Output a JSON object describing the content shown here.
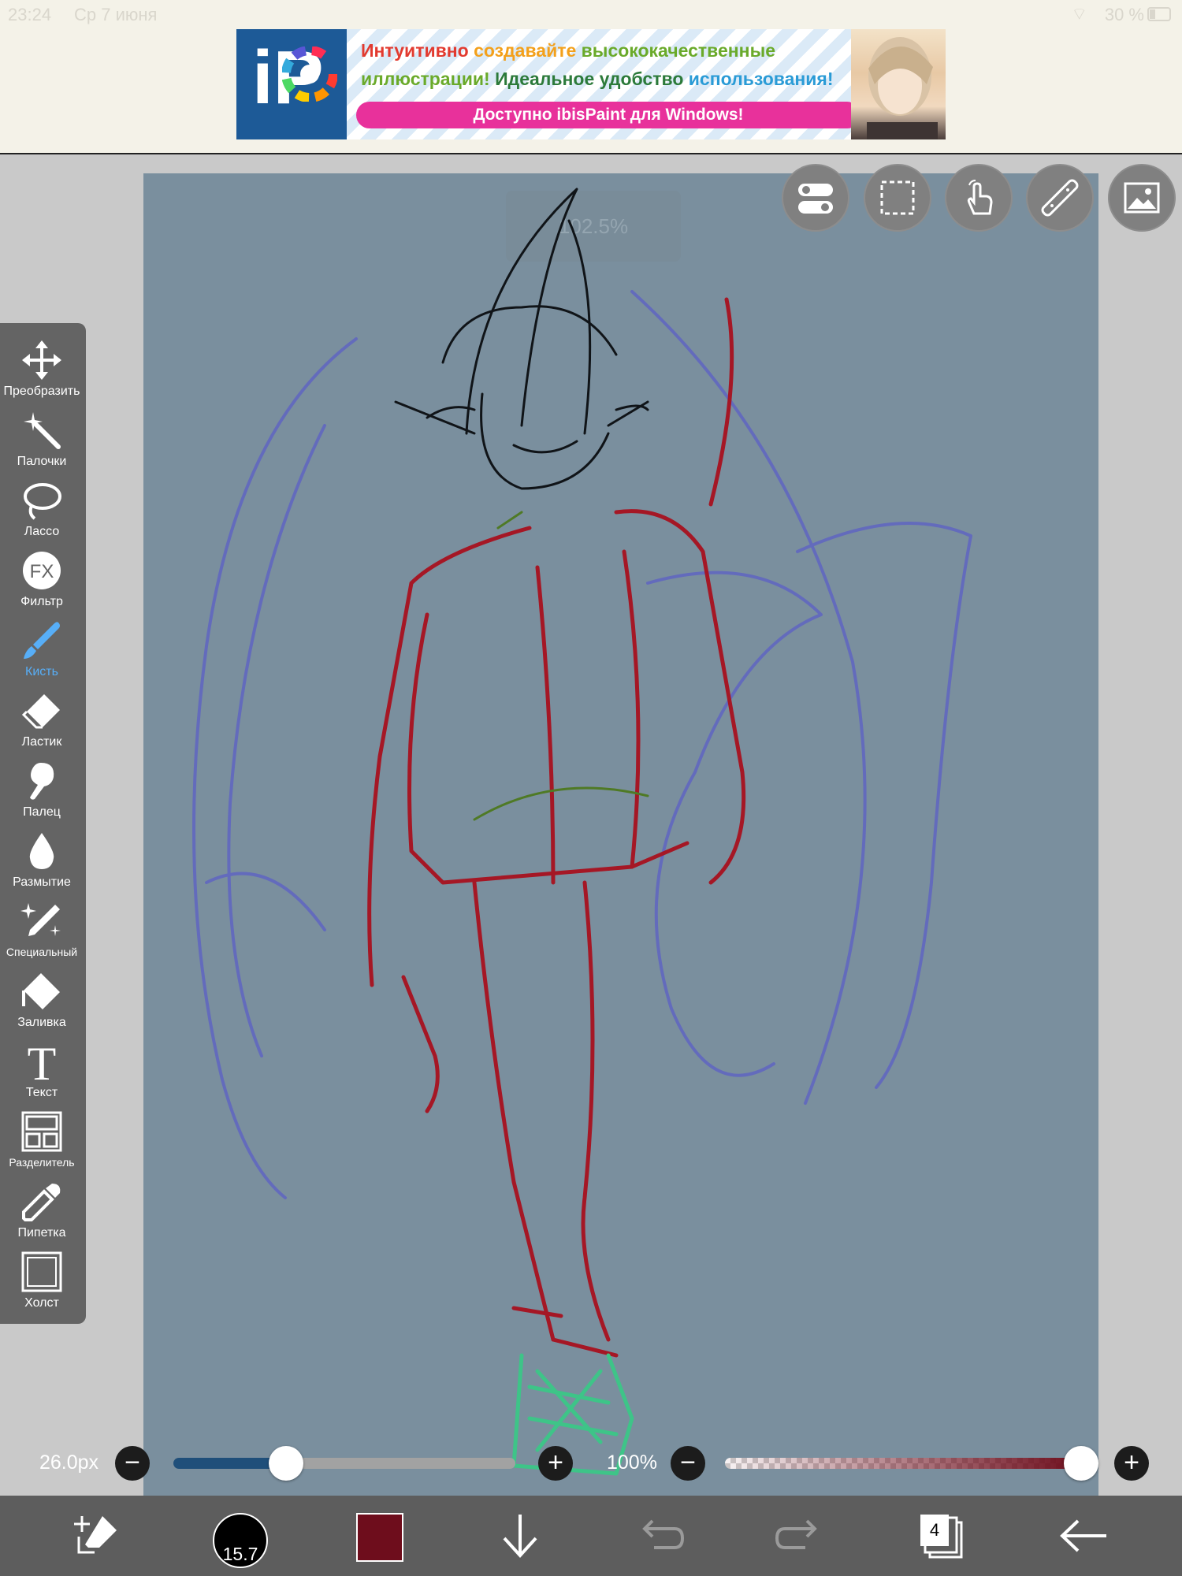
{
  "status_bar": {
    "time": "23:24",
    "date": "Ср 7 июня",
    "battery": "30 %"
  },
  "ad": {
    "line1": [
      {
        "text": "Интуитивно ",
        "color": "#e23a2f"
      },
      {
        "text": "создавайте ",
        "color": "#f3a01b"
      },
      {
        "text": "высококачественные",
        "color": "#6aaa2a"
      }
    ],
    "line2": [
      {
        "text": "иллюстрации! ",
        "color": "#6aaa2a"
      },
      {
        "text": "Идеальное удобство ",
        "color": "#2c7a3a"
      },
      {
        "text": "использования!",
        "color": "#2a9bd6"
      }
    ],
    "cta": "Доступно ibisPaint для Windows!",
    "logo_text": "iP"
  },
  "canvas": {
    "zoom_overlay": "102.5%",
    "background": "#7a8f9e"
  },
  "tools": [
    {
      "name": "transform",
      "label": "Преобразить",
      "icon": "move-arrows-icon"
    },
    {
      "name": "magic-wand",
      "label": "Палочки",
      "icon": "magic-wand-icon"
    },
    {
      "name": "lasso",
      "label": "Лассо",
      "icon": "lasso-icon"
    },
    {
      "name": "filter",
      "label": "Фильтр",
      "icon": "fx-icon"
    },
    {
      "name": "brush",
      "label": "Кисть",
      "icon": "brush-icon",
      "active": true
    },
    {
      "name": "eraser",
      "label": "Ластик",
      "icon": "eraser-icon"
    },
    {
      "name": "smudge",
      "label": "Палец",
      "icon": "finger-icon"
    },
    {
      "name": "blur",
      "label": "Размытие",
      "icon": "drop-icon"
    },
    {
      "name": "special",
      "label": "Специальный",
      "icon": "sparkle-pen-icon"
    },
    {
      "name": "fill",
      "label": "Заливка",
      "icon": "fill-bucket-icon"
    },
    {
      "name": "text",
      "label": "Текст",
      "icon": "text-t-icon"
    },
    {
      "name": "divider",
      "label": "Разделитель",
      "icon": "frame-divider-icon"
    },
    {
      "name": "eyedropper",
      "label": "Пипетка",
      "icon": "eyedropper-icon"
    },
    {
      "name": "canvas",
      "label": "Холст",
      "icon": "canvas-square-icon"
    }
  ],
  "brush": {
    "size": "26.0px",
    "size_fraction": 0.33,
    "opacity": "100%",
    "opacity_fraction": 1.0,
    "preview_size": "15.7"
  },
  "colors": {
    "current": "#6e0d1c",
    "size_slider": "#1f4f7a",
    "accent": "#57aef7"
  },
  "layers": {
    "count": "4"
  }
}
